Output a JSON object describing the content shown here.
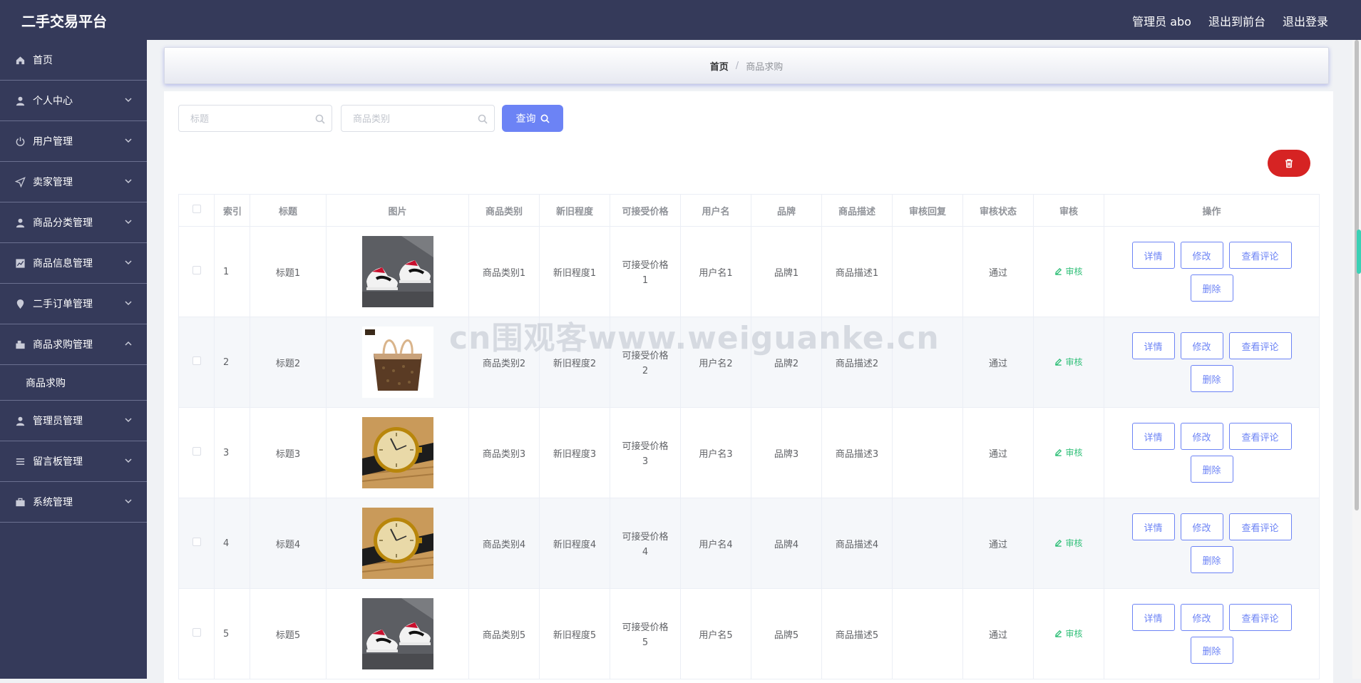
{
  "app": {
    "title": "二手交易平台"
  },
  "header": {
    "admin": "管理员 abo",
    "front": "退出到前台",
    "logout": "退出登录"
  },
  "sidebar": {
    "items": [
      {
        "label": "首页",
        "icon": "home-icon"
      },
      {
        "label": "个人中心",
        "icon": "user-icon"
      },
      {
        "label": "用户管理",
        "icon": "power-icon"
      },
      {
        "label": "卖家管理",
        "icon": "send-icon"
      },
      {
        "label": "商品分类管理",
        "icon": "user-icon"
      },
      {
        "label": "商品信息管理",
        "icon": "chart-icon"
      },
      {
        "label": "二手订单管理",
        "icon": "location-icon"
      },
      {
        "label": "商品求购管理",
        "icon": "cart-icon"
      },
      {
        "label": "管理员管理",
        "icon": "user-icon"
      },
      {
        "label": "留言板管理",
        "icon": "list-icon"
      },
      {
        "label": "系统管理",
        "icon": "briefcase-icon"
      }
    ],
    "submenu": "商品求购"
  },
  "breadcrumb": {
    "home": "首页",
    "sep": "/",
    "current": "商品求购"
  },
  "search": {
    "title_placeholder": "标题",
    "category_placeholder": "商品类别",
    "query_label": "查询"
  },
  "table": {
    "headers": [
      "索引",
      "标题",
      "图片",
      "商品类别",
      "新旧程度",
      "可接受价格",
      "用户名",
      "品牌",
      "商品描述",
      "审核回复",
      "审核状态",
      "审核",
      "操作"
    ],
    "rows": [
      {
        "index": "1",
        "title": "标题1",
        "image": "sneaker",
        "category": "商品类别1",
        "condition": "新旧程度1",
        "price_a": "可接受价格",
        "price_b": "1",
        "user": "用户名1",
        "brand": "品牌1",
        "desc": "商品描述1",
        "reply": "",
        "status": "通过"
      },
      {
        "index": "2",
        "title": "标题2",
        "image": "bag",
        "category": "商品类别2",
        "condition": "新旧程度2",
        "price_a": "可接受价格",
        "price_b": "2",
        "user": "用户名2",
        "brand": "品牌2",
        "desc": "商品描述2",
        "reply": "",
        "status": "通过"
      },
      {
        "index": "3",
        "title": "标题3",
        "image": "watch",
        "category": "商品类别3",
        "condition": "新旧程度3",
        "price_a": "可接受价格",
        "price_b": "3",
        "user": "用户名3",
        "brand": "品牌3",
        "desc": "商品描述3",
        "reply": "",
        "status": "通过"
      },
      {
        "index": "4",
        "title": "标题4",
        "image": "watch",
        "category": "商品类别4",
        "condition": "新旧程度4",
        "price_a": "可接受价格",
        "price_b": "4",
        "user": "用户名4",
        "brand": "品牌4",
        "desc": "商品描述4",
        "reply": "",
        "status": "通过"
      },
      {
        "index": "5",
        "title": "标题5",
        "image": "sneaker",
        "category": "商品类别5",
        "condition": "新旧程度5",
        "price_a": "可接受价格",
        "price_b": "5",
        "user": "用户名5",
        "brand": "品牌5",
        "desc": "商品描述5",
        "reply": "",
        "status": "通过"
      }
    ],
    "audit_label": "审核",
    "ops": {
      "detail": "详情",
      "edit": "修改",
      "comments": "查看评论",
      "delete": "删除"
    }
  },
  "watermark": "cn围观客www.weiguanke.cn",
  "colors": {
    "sidebar": "#353a5a",
    "primary": "#6c83f5",
    "danger": "#d62323",
    "success": "#33c07a"
  }
}
